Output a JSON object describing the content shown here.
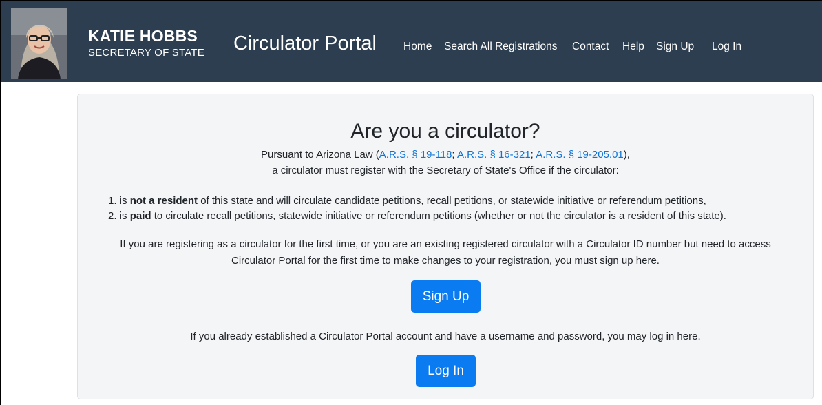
{
  "header": {
    "brand_name": "KATIE HOBBS",
    "brand_subtitle": "SECRETARY OF STATE",
    "portal_title": "Circulator Portal",
    "nav": [
      "Home",
      "Search All Registrations",
      "Contact",
      "Help",
      "Sign Up",
      "Log In"
    ],
    "bg_color": "#2d3e50"
  },
  "main": {
    "heading": "Are you a circulator?",
    "intro_prefix": "Pursuant to Arizona Law (",
    "law_links": [
      "A.R.S. § 19-118",
      "A.R.S. § 16-321",
      "A.R.S. § 19-205.01"
    ],
    "link_sep": "; ",
    "intro_suffix": "),",
    "intro_line2": "a circulator must register with the Secretary of State's Office if the circulator:",
    "requirements": [
      {
        "num": "1. is ",
        "bold": "not a resident",
        "rest": " of this state and will circulate candidate petitions, recall petitions, or statewide initiative or referendum petitions,"
      },
      {
        "num": "2. is ",
        "bold": "paid",
        "rest": " to circulate recall petitions, statewide initiative or referendum petitions (whether or not the circulator is a resident of this state)."
      }
    ],
    "signup_text_line1": "If you are registering as a circulator for the first time, or you are an existing registered circulator with a Circulator ID number but need to access",
    "signup_text_line2": "Circulator Portal for the first time to make changes to your registration, you must sign up here.",
    "signup_button": "Sign Up",
    "login_text": "If you already established a Circulator Portal account and have a username and password, you may log in here.",
    "login_button": "Log In",
    "link_color": "#0d74d6",
    "button_color": "#0a7bf0"
  }
}
